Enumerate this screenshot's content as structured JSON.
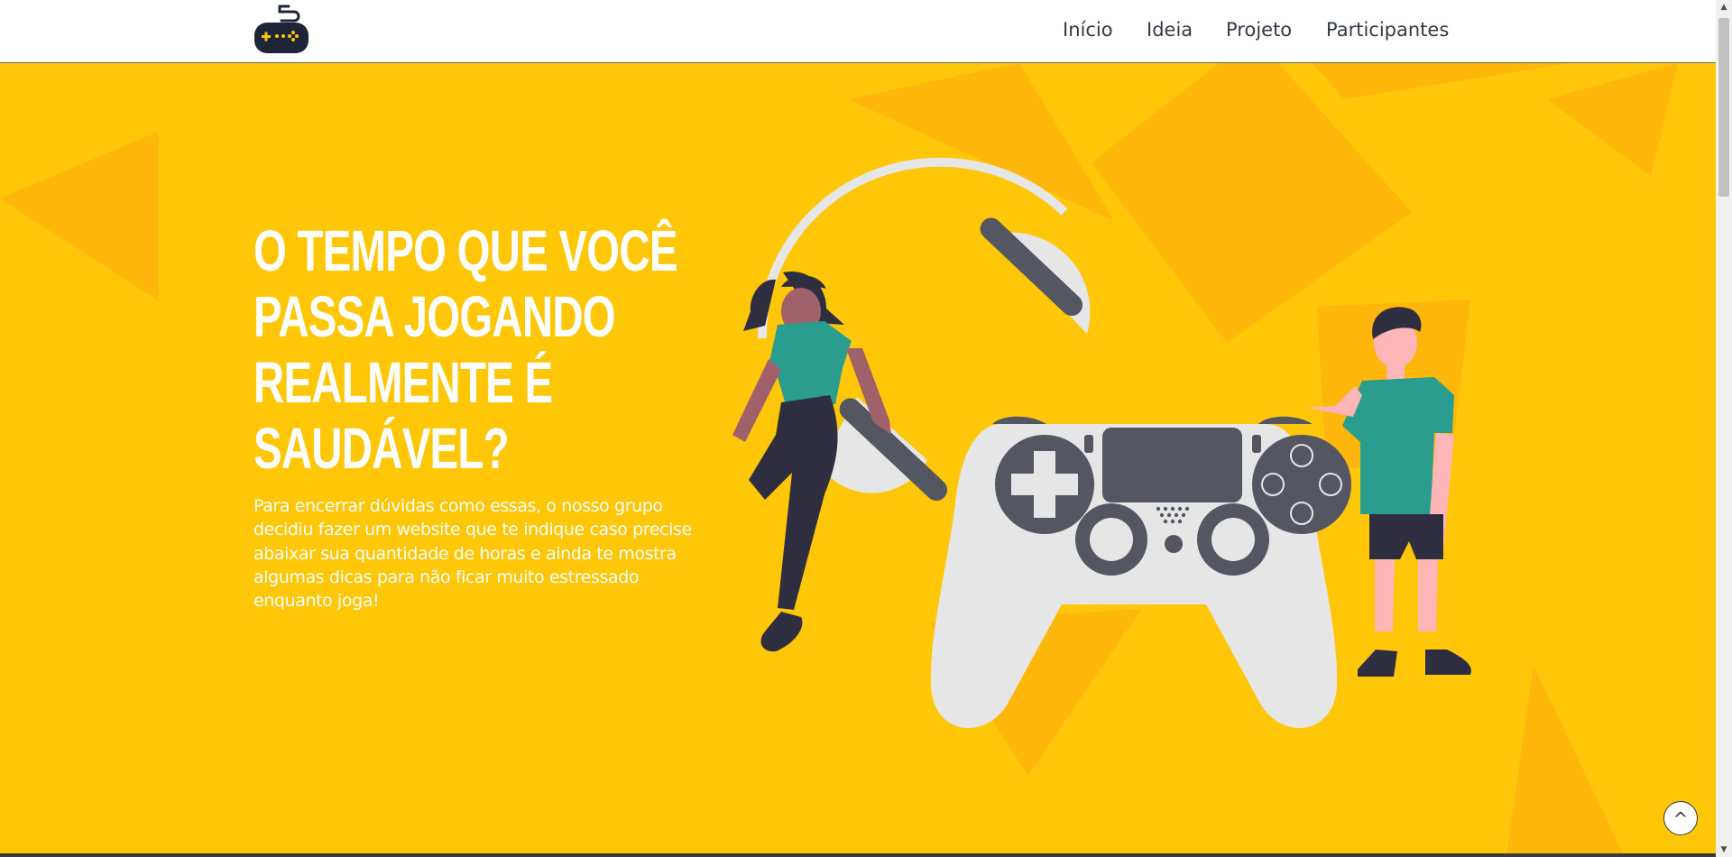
{
  "header": {
    "logo_icon": "gamepad-icon",
    "nav": {
      "inicio": "Início",
      "ideia": "Ideia",
      "projeto": "Projeto",
      "participantes": "Participantes"
    }
  },
  "hero": {
    "title_lines": [
      "O TEMPO QUE VOCÊ",
      "PASSA JOGANDO",
      "REALMENTE É",
      "SAUDÁVEL?"
    ],
    "description": "Para encerrar dúvidas como essas, o nosso grupo decidiu fazer um website que te indique caso precise abaixar sua quantidade de horas e ainda te mostra algumas dicas para não ficar muito estressado enquanto joga!",
    "illustration": "gamers-with-controller-and-headphones-illustration"
  },
  "scroll_top": {
    "label": "^",
    "icon": "arrow-up-icon"
  },
  "colors": {
    "hero_background": "#ffc708",
    "decor_shapes": "#ffb70c",
    "nav_text": "#333a44",
    "title_text": "#ffffff",
    "controller": "#e6e6e6",
    "controller_dark": "#545761",
    "shirt": "#2a9d8f",
    "skin_dark": "#a0616a",
    "skin_light": "#ffb6b6"
  }
}
